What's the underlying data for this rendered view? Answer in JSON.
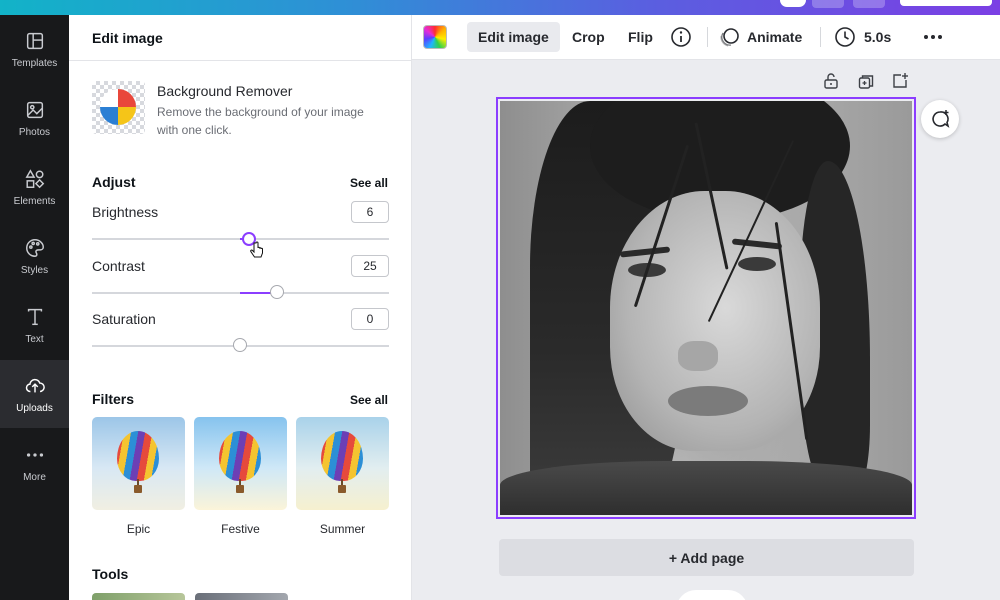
{
  "rail": {
    "items": [
      {
        "label": "Templates",
        "icon": "templates-icon"
      },
      {
        "label": "Photos",
        "icon": "photos-icon"
      },
      {
        "label": "Elements",
        "icon": "elements-icon"
      },
      {
        "label": "Styles",
        "icon": "styles-icon"
      },
      {
        "label": "Text",
        "icon": "text-icon"
      },
      {
        "label": "Uploads",
        "icon": "uploads-icon"
      },
      {
        "label": "More",
        "icon": "more-icon"
      }
    ],
    "active": "Uploads"
  },
  "panel": {
    "title": "Edit image",
    "bg_remover": {
      "title": "Background Remover",
      "description": "Remove the background of your image with one click."
    },
    "adjust": {
      "title": "Adjust",
      "see_all": "See all",
      "brightness": {
        "label": "Brightness",
        "value": "6"
      },
      "contrast": {
        "label": "Contrast",
        "value": "25"
      },
      "saturation": {
        "label": "Saturation",
        "value": "0"
      }
    },
    "filters": {
      "title": "Filters",
      "see_all": "See all",
      "items": [
        {
          "label": "Epic"
        },
        {
          "label": "Festive"
        },
        {
          "label": "Summer"
        }
      ]
    },
    "tools": {
      "title": "Tools"
    }
  },
  "toolbar": {
    "edit_image": "Edit image",
    "crop": "Crop",
    "flip": "Flip",
    "animate": "Animate",
    "duration": "5.0s"
  },
  "canvas": {
    "add_page": "+ Add page"
  },
  "colors": {
    "accent": "#8b3dff",
    "rail_bg": "#18191b"
  }
}
